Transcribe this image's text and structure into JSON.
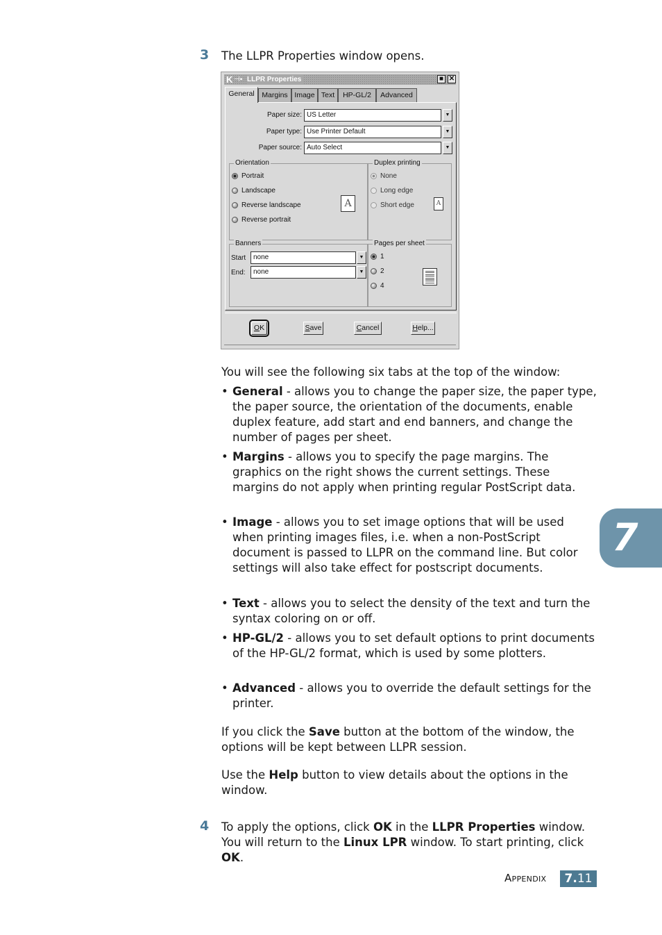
{
  "step3": {
    "number": "3",
    "text": "The LLPR Properties window opens."
  },
  "dialog": {
    "title": "LLPR Properties",
    "title_app_icon": "K",
    "titlebar_buttons": {
      "maximize": "■",
      "close": "✕"
    },
    "tabs": [
      {
        "label": "General",
        "active": true
      },
      {
        "label": "Margins",
        "active": false
      },
      {
        "label": "Image",
        "active": false
      },
      {
        "label": "Text",
        "active": false
      },
      {
        "label": "HP-GL/2",
        "active": false
      },
      {
        "label": "Advanced",
        "active": false
      }
    ],
    "fields": {
      "paper_size": {
        "label": "Paper size:",
        "value": "US Letter"
      },
      "paper_type": {
        "label": "Paper type:",
        "value": "Use Printer Default"
      },
      "paper_source": {
        "label": "Paper source:",
        "value": "Auto Select"
      }
    },
    "orientation": {
      "title": "Orientation",
      "options": [
        {
          "label": "Portrait",
          "selected": true
        },
        {
          "label": "Landscape",
          "selected": false
        },
        {
          "label": "Reverse landscape",
          "selected": false
        },
        {
          "label": "Reverse portrait",
          "selected": false
        }
      ],
      "preview_glyph": "A"
    },
    "duplex": {
      "title": "Duplex printing",
      "options": [
        {
          "label": "None",
          "selected": true
        },
        {
          "label": "Long edge",
          "selected": false
        },
        {
          "label": "Short edge",
          "selected": false
        }
      ],
      "preview_glyph": "A"
    },
    "banners": {
      "title": "Banners",
      "start": {
        "label": "Start",
        "value": "none"
      },
      "end": {
        "label": "End:",
        "value": "none"
      }
    },
    "pages_per_sheet": {
      "title": "Pages per sheet",
      "options": [
        {
          "label": "1",
          "selected": true
        },
        {
          "label": "2",
          "selected": false
        },
        {
          "label": "4",
          "selected": false
        }
      ]
    },
    "buttons": {
      "ok": {
        "mnemonic": "O",
        "rest": "K"
      },
      "save": {
        "mnemonic": "S",
        "rest": "ave"
      },
      "cancel": {
        "mnemonic": "C",
        "rest": "ancel"
      },
      "help": {
        "mnemonic": "H",
        "rest": "elp..."
      }
    }
  },
  "intro": "You will see the following six tabs at the top of the window:",
  "bullets": [
    {
      "term": "General",
      "desc": " - allows you to change the paper size, the paper type, the paper source, the orientation of the documents, enable duplex feature, add start and end banners, and change the number of pages per sheet."
    },
    {
      "term": "Margins",
      "desc": " - allows you to specify the page margins. The graphics on the right shows the current settings. These margins do not apply when printing regular PostScript data."
    },
    {
      "term": "Image",
      "desc": " - allows you to set image options that will be used when printing images files, i.e. when a non-PostScript document is passed to LLPR on the command line. But color settings will also take effect for postscript documents."
    },
    {
      "term": "Text",
      "desc": " - allows you to select the density of the text and turn the syntax coloring on or off."
    },
    {
      "term": "HP-GL/2",
      "desc": " - allows you to set default options to print documents of the HP-GL/2 format, which is used by some plotters."
    },
    {
      "term": "Advanced",
      "desc": " - allows you to override the default settings for the printer."
    }
  ],
  "save_para": {
    "before": "If you click the ",
    "bold": "Save",
    "after": " button at the bottom of the window, the options will be kept between LLPR session."
  },
  "help_para": {
    "before": "Use the ",
    "bold": "Help",
    "after": " button to view details about the options in the window."
  },
  "step4": {
    "number": "4",
    "parts": [
      "To apply the options, click ",
      "OK",
      " in the ",
      "LLPR Properties",
      " window. You will return to the ",
      "Linux LPR",
      " window. To start printing, click ",
      "OK",
      "."
    ]
  },
  "chapter_tab": "7",
  "footer": {
    "label": "Appendix",
    "chapter": "7.",
    "page": "11"
  },
  "colors": {
    "accent": "#4d7a92",
    "chapter_tab": "#6e94aa",
    "step_number": "#4a7a98"
  }
}
